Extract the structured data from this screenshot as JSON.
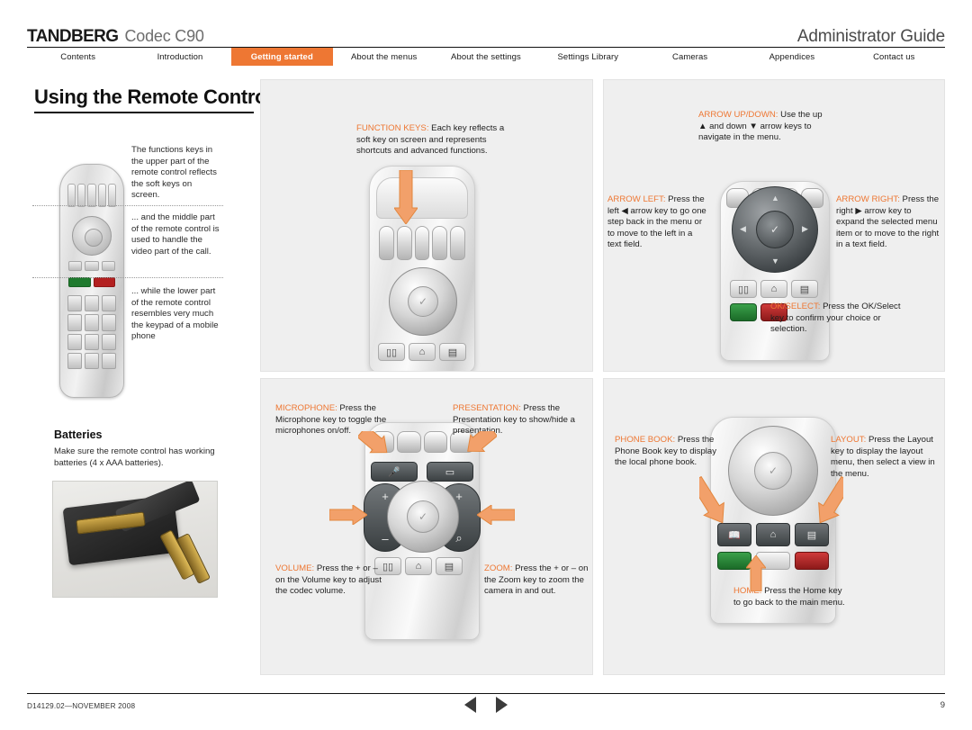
{
  "header": {
    "brand": "TANDBERG",
    "product": "Codec C90",
    "guide_title": "Administrator Guide"
  },
  "nav": {
    "items": [
      {
        "label": "Contents",
        "active": false
      },
      {
        "label": "Introduction",
        "active": false
      },
      {
        "label": "Getting started",
        "active": true
      },
      {
        "label": "About the menus",
        "active": false
      },
      {
        "label": "About the settings",
        "active": false
      },
      {
        "label": "Settings Library",
        "active": false
      },
      {
        "label": "Cameras",
        "active": false
      },
      {
        "label": "Appendices",
        "active": false
      },
      {
        "label": "Contact us",
        "active": false
      }
    ]
  },
  "page": {
    "title": "Using the Remote Control",
    "sidenotes": [
      "The functions keys in the upper part of the remote control reflects the soft keys on screen.",
      "... and the middle part of the remote control is used to handle the video part of the call.",
      "... while the lower part of the remote control resembles very much the keypad of a mobile phone"
    ],
    "batteries_heading": "Batteries",
    "batteries_text": "Make sure the remote control has working batteries (4 x AAA batteries)."
  },
  "panels": {
    "function_keys": {
      "label": "FUNCTION KEYS:",
      "text": " Each key reflects a soft key on screen and represents shortcuts and advanced functions."
    },
    "arrow_updown": {
      "label": "ARROW UP/DOWN:",
      "text": " Use the up ▲ and down ▼ arrow keys to navigate in the menu."
    },
    "arrow_left": {
      "label": "ARROW LEFT:",
      "text": " Press the left ◀ arrow key to go one step back in the menu or to move to the left in a text field."
    },
    "arrow_right": {
      "label": "ARROW RIGHT:",
      "text": " Press the right ▶ arrow key to expand the selected menu item or to move to the right in a text field."
    },
    "ok_select": {
      "label": "OK/SELECT:",
      "text": " Press the OK/Select key to confirm your choice or selection."
    },
    "microphone": {
      "label": "MICROPHONE:",
      "text": " Press the Microphone key to toggle the microphones on/off."
    },
    "presentation": {
      "label": "PRESENTATION:",
      "text": " Press the Presentation key to show/hide a presentation."
    },
    "volume": {
      "label": "VOLUME:",
      "text": " Press the + or – on the Volume key to adjust the codec volume."
    },
    "zoom": {
      "label": "ZOOM:",
      "text": " Press the + or – on the Zoom key to zoom the camera in and out."
    },
    "phone_book": {
      "label": "PHONE BOOK:",
      "text": " Press the Phone Book key to display the local phone book."
    },
    "layout": {
      "label": "LAYOUT:",
      "text": " Press the Layout key to display the layout menu, then select a view in the menu."
    },
    "home": {
      "label": "HOME:",
      "text": " Press the Home key to go back to the main menu."
    }
  },
  "footer": {
    "doc_id": "D14129.02—NOVEMBER 2008",
    "page_number": "9"
  },
  "colors": {
    "accent": "#ee7733",
    "panel_bg": "#efefef",
    "text": "#1f1f1f"
  }
}
